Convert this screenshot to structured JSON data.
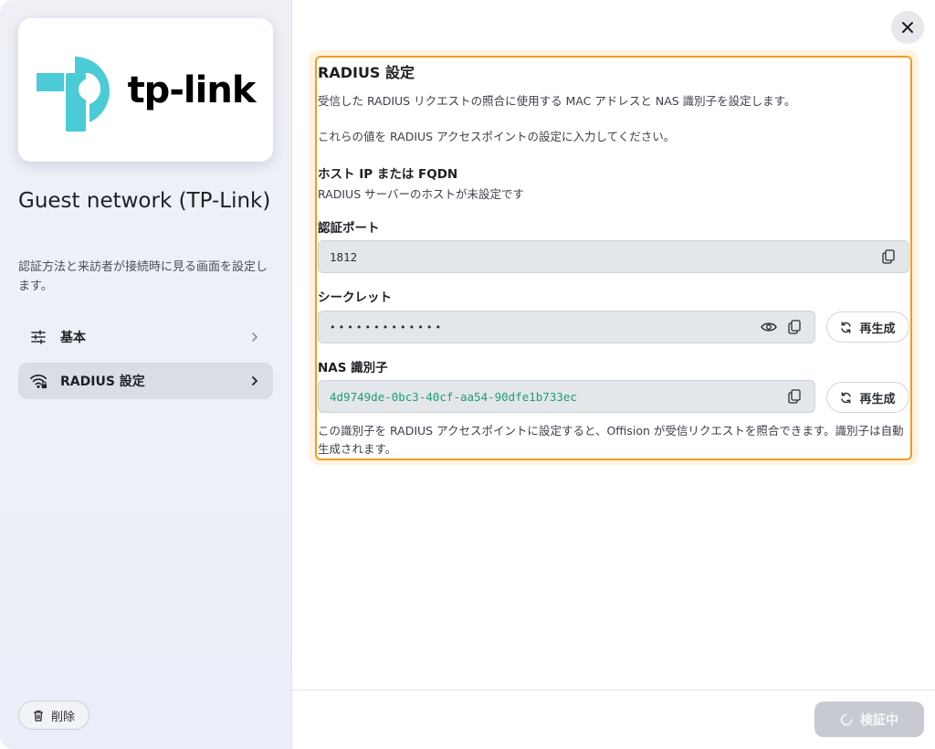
{
  "sidebar": {
    "logo_text": "tp-link",
    "app_name": "Guest network (TP-Link)",
    "app_description": "認証方法と来訪者が接続時に見る画面を設定します。",
    "nav": [
      {
        "label": "基本",
        "icon": "sliders-icon"
      },
      {
        "label": "RADIUS 設定",
        "icon": "wifi-lock-icon",
        "active": true
      }
    ],
    "delete_label": "削除"
  },
  "radius": {
    "title": "RADIUS 設定",
    "description": "受信した RADIUS リクエストの照合に使用する MAC アドレスと NAS 識別子を設定します。",
    "instruction": "これらの値を RADIUS アクセスポイントの設定に入力してください。",
    "host_label": "ホスト IP または FQDN",
    "host_value": "RADIUS サーバーのホストが未設定です",
    "port_label": "認証ポート",
    "port_value": "1812",
    "secret_label": "シークレット",
    "secret_value": "•••••••••••••",
    "nas_label": "NAS 識別子",
    "nas_value": "4d9749de-0bc3-40cf-aa54-90dfe1b733ec",
    "regen_label": "再生成",
    "nas_help": "この識別子を RADIUS アクセスポイントに設定すると、Offision が受信リクエストを照合できます。識別子は自動生成されます。"
  },
  "footer": {
    "verify_label": "検証中"
  },
  "colors": {
    "accent_orange": "#f39c1a",
    "nas_green": "#1f9e74",
    "logo_teal": "#4acbd6"
  }
}
